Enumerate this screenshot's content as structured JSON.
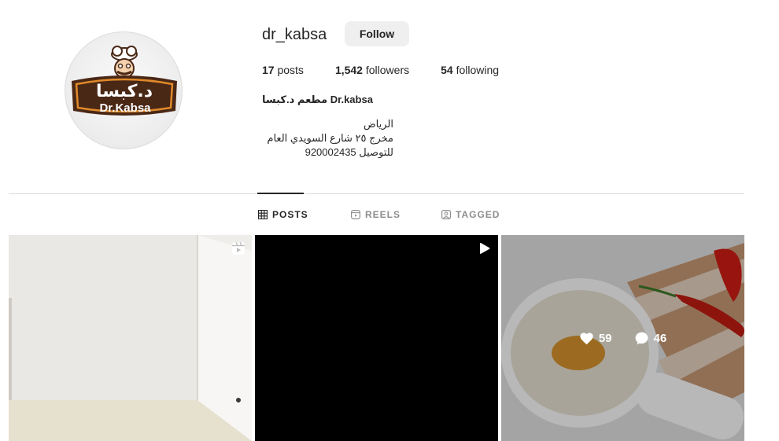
{
  "profile": {
    "username": "dr_kabsa",
    "follow_label": "Follow",
    "avatar": {
      "logo_arabic": "د.كبسا",
      "logo_latin": "Dr.Kabsa"
    },
    "stats": {
      "posts_count": "17",
      "posts_label": "posts",
      "followers_count": "1,542",
      "followers_label": "followers",
      "following_count": "54",
      "following_label": "following"
    },
    "full_name": "مطعم د.كبسا Dr.kabsa",
    "bio_lines": [
      "الرياض",
      "مخرج ٢٥ شارع السويدي العام",
      "920002435 للتوصيل"
    ]
  },
  "tabs": [
    {
      "label": "POSTS",
      "icon": "grid-icon",
      "active": true
    },
    {
      "label": "REELS",
      "icon": "reels-icon",
      "active": false
    },
    {
      "label": "TAGGED",
      "icon": "tagged-icon",
      "active": false
    }
  ],
  "posts": [
    {
      "type": "reel",
      "corner_icon": "reels-icon"
    },
    {
      "type": "video",
      "corner_icon": "play-icon"
    },
    {
      "type": "photo",
      "likes": "59",
      "comments": "46",
      "hover": true
    }
  ],
  "colors": {
    "text": "#262626",
    "muted": "#8e8e8e",
    "divider": "#dbdbdb",
    "button_bg": "#efefef",
    "logo_brown": "#4a2816",
    "logo_orange": "#e08a2a"
  }
}
